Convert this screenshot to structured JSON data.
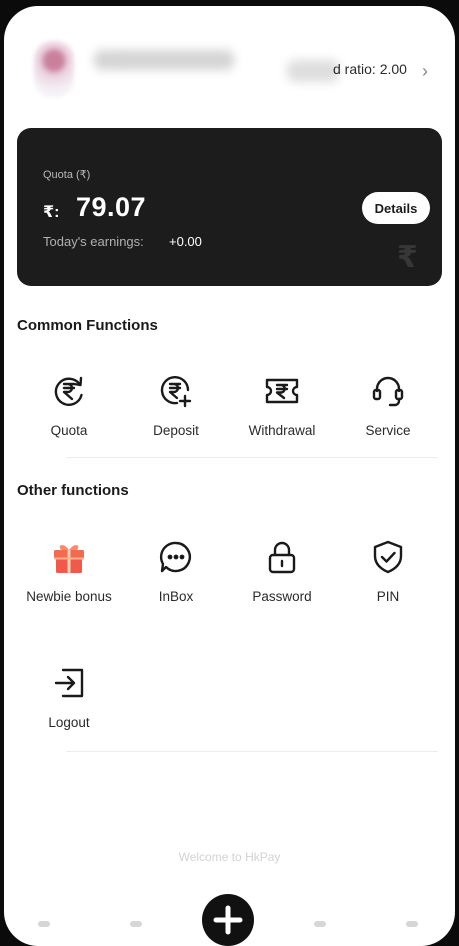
{
  "header": {
    "username": "",
    "ratio_text": "d ratio: 2.00",
    "chevron": "›"
  },
  "card": {
    "quota_label": "Quota (₹)",
    "currency": "₹:",
    "amount": "79.07",
    "earnings_label": "Today's earnings:",
    "earnings_value": "+0.00",
    "details_label": "Details"
  },
  "common": {
    "title": "Common Functions",
    "items": [
      {
        "label": "Quota",
        "icon": "rupee-refresh-icon"
      },
      {
        "label": "Deposit",
        "icon": "rupee-plus-icon"
      },
      {
        "label": "Withdrawal",
        "icon": "rupee-ticket-icon"
      },
      {
        "label": "Service",
        "icon": "headset-icon"
      }
    ]
  },
  "other": {
    "title": "Other functions",
    "items": [
      {
        "label": "Newbie bonus",
        "icon": "gift-icon"
      },
      {
        "label": "InBox",
        "icon": "chat-bubble-icon"
      },
      {
        "label": "Password",
        "icon": "lock-icon"
      },
      {
        "label": "PIN",
        "icon": "shield-check-icon"
      },
      {
        "label": "Logout",
        "icon": "logout-icon"
      }
    ]
  },
  "footer": {
    "welcome": "Welcome to HkPay"
  },
  "colors": {
    "card_bg": "#1c1c1c",
    "gift_accent": "#f15a4a",
    "text": "#1a1a1a"
  }
}
